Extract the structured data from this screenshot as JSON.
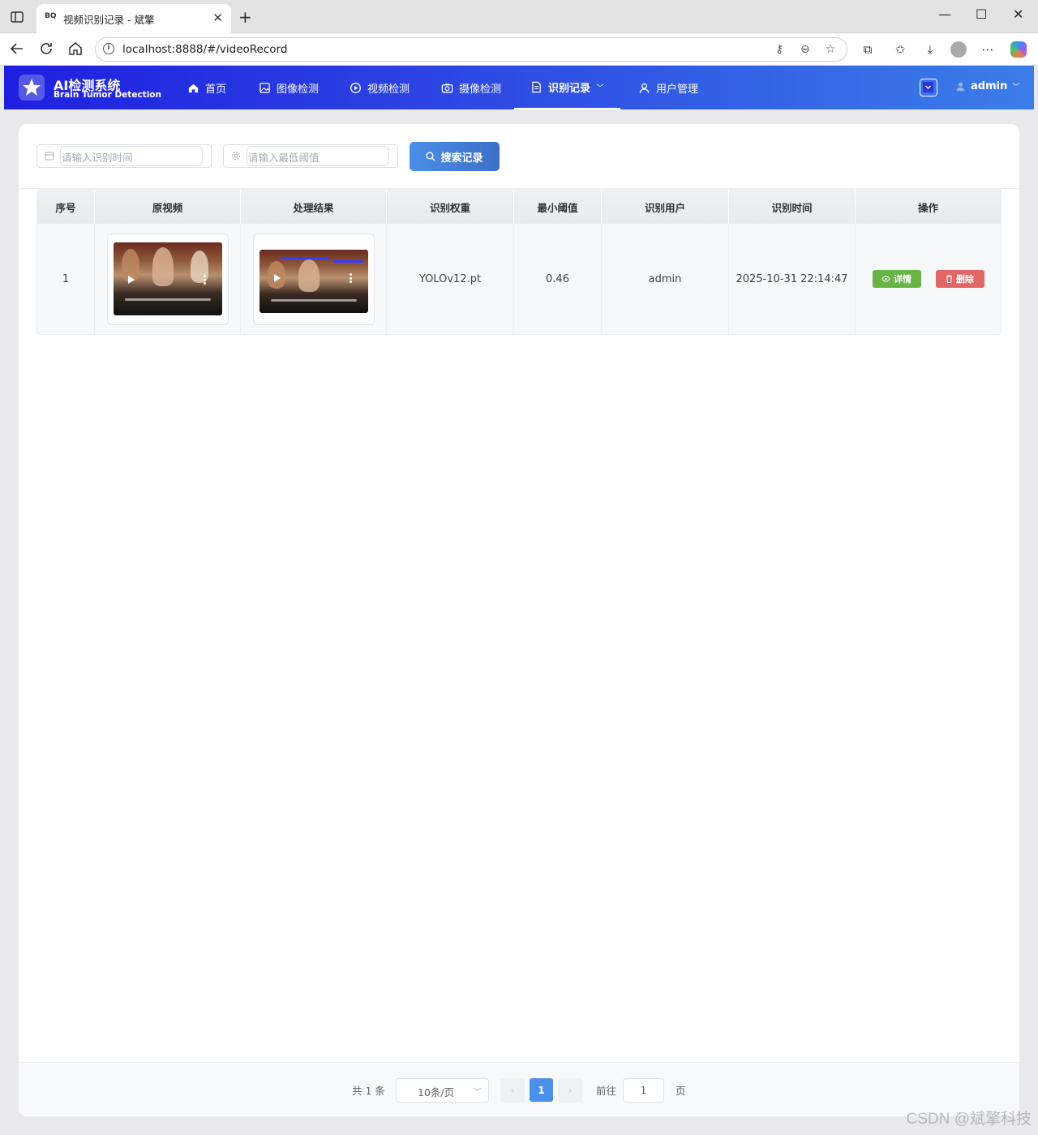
{
  "browser": {
    "tab_title": "视频识别记录 - 斌擎",
    "tab_favicon": "BQ",
    "url": "localhost:8888/#/videoRecord"
  },
  "app": {
    "title": "AI检测系统",
    "subtitle": "Brain Tumor Detection",
    "menu": [
      {
        "label": "首页",
        "icon": "home-icon"
      },
      {
        "label": "图像检测",
        "icon": "image-icon"
      },
      {
        "label": "视频检测",
        "icon": "play-circle-icon"
      },
      {
        "label": "摄像检测",
        "icon": "camera-icon"
      },
      {
        "label": "识别记录",
        "icon": "document-icon",
        "active": true
      },
      {
        "label": "用户管理",
        "icon": "user-icon"
      }
    ],
    "user": "admin"
  },
  "search": {
    "time_placeholder": "请输入识别时间",
    "threshold_placeholder": "请输入最低阈值",
    "button_label": "搜索记录"
  },
  "table": {
    "columns": [
      "序号",
      "原视频",
      "处理结果",
      "识别权重",
      "最小阈值",
      "识别用户",
      "识别时间",
      "操作"
    ],
    "rows": [
      {
        "index": "1",
        "weight": "YOLOv12.pt",
        "threshold": "0.46",
        "user": "admin",
        "time": "2025-10-31 22:14:47"
      }
    ],
    "actions": {
      "detail": "详情",
      "delete": "删除"
    }
  },
  "pagination": {
    "total": "共 1 条",
    "page_size": "10条/页",
    "current_page": "1",
    "goto_label": "前往",
    "goto_value": "1",
    "page_suffix": "页"
  },
  "watermark": "CSDN @斌擎科技",
  "colors": {
    "header_start": "#1f1fe0",
    "header_end": "#3b7de8",
    "primary": "#4a90e8",
    "detail_green": "#67b346",
    "delete_red": "#e06565"
  }
}
